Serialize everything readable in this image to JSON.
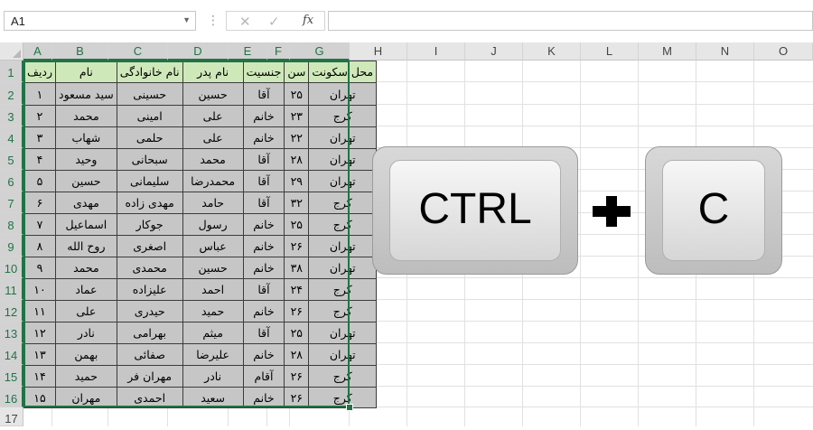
{
  "formula_bar": {
    "name_box": "A1",
    "fx_label": "fx",
    "cancel_icon": "close-icon",
    "enter_icon": "check-icon",
    "formula": ""
  },
  "columns": [
    "A",
    "B",
    "C",
    "D",
    "E",
    "F",
    "G",
    "H",
    "I",
    "J",
    "K",
    "L",
    "M",
    "N",
    "O"
  ],
  "rows": [
    "1",
    "2",
    "3",
    "4",
    "5",
    "6",
    "7",
    "8",
    "9",
    "10",
    "11",
    "12",
    "13",
    "14",
    "15",
    "16",
    "17"
  ],
  "table": {
    "headers": [
      "ردیف",
      "نام",
      "نام خانوادگی",
      "نام پدر",
      "جنسیت",
      "سن",
      "محل سکونت"
    ],
    "rows": [
      [
        "۱",
        "سید مسعود",
        "حسینی",
        "حسین",
        "آقا",
        "۲۵",
        "تهران"
      ],
      [
        "۲",
        "محمد",
        "امینی",
        "علی",
        "خانم",
        "۲۳",
        "کرج"
      ],
      [
        "۳",
        "شهاب",
        "حلمی",
        "علی",
        "خانم",
        "۲۲",
        "تهران"
      ],
      [
        "۴",
        "وحید",
        "سبحانی",
        "محمد",
        "آقا",
        "۲۸",
        "تهران"
      ],
      [
        "۵",
        "حسین",
        "سلیمانی",
        "محمدرضا",
        "آقا",
        "۲۹",
        "تهران"
      ],
      [
        "۶",
        "مهدی",
        "مهدی زاده",
        "حامد",
        "آقا",
        "۳۲",
        "کرج"
      ],
      [
        "۷",
        "اسماعیل",
        "جوکار",
        "رسول",
        "خانم",
        "۲۵",
        "کرج"
      ],
      [
        "۸",
        "روح الله",
        "اصغری",
        "عباس",
        "خانم",
        "۲۶",
        "تهران"
      ],
      [
        "۹",
        "محمد",
        "محمدی",
        "حسین",
        "خانم",
        "۳۸",
        "تهران"
      ],
      [
        "۱۰",
        "عماد",
        "علیزاده",
        "احمد",
        "آقا",
        "۲۴",
        "کرج"
      ],
      [
        "۱۱",
        "علی",
        "حیدری",
        "حمید",
        "خانم",
        "۲۶",
        "کرج"
      ],
      [
        "۱۲",
        "نادر",
        "بهرامی",
        "میثم",
        "آقا",
        "۲۵",
        "تهران"
      ],
      [
        "۱۳",
        "بهمن",
        "صفائی",
        "علیرضا",
        "خانم",
        "۲۸",
        "تهران"
      ],
      [
        "۱۴",
        "حمید",
        "مهران فر",
        "نادر",
        "آقام",
        "۲۶",
        "کرج"
      ],
      [
        "۱۵",
        "مهران",
        "احمدی",
        "سعید",
        "خانم",
        "۲۶",
        "کرج"
      ]
    ]
  },
  "keys": {
    "ctrl": "CTRL",
    "c": "C"
  },
  "colors": {
    "accent": "#217346",
    "header_fill": "#cfe8b9",
    "body_fill": "#c6c6c6"
  }
}
